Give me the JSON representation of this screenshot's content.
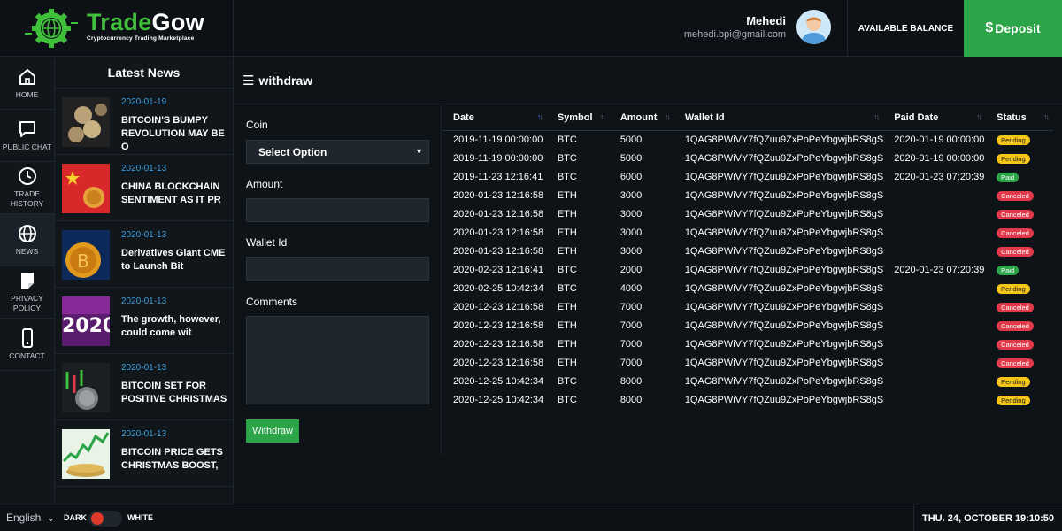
{
  "brand": {
    "name_part1": "Trade",
    "name_part2": "Gow",
    "tagline": "Cryptocurrency Trading Marketplace"
  },
  "user": {
    "name": "Mehedi",
    "email": "mehedi.bpi@gmail.com"
  },
  "header": {
    "balance_label": "AVAILABLE BALANCE",
    "deposit_symbol": "$",
    "deposit_label": "Deposit"
  },
  "sidebar": {
    "items": [
      {
        "label": "HOME",
        "icon": "home-icon"
      },
      {
        "label": "PUBLIC CHAT",
        "icon": "chat-icon"
      },
      {
        "label": "TRADE HISTORY",
        "icon": "clock-icon"
      },
      {
        "label": "NEWS",
        "icon": "globe-icon"
      },
      {
        "label": "PRIVACY POLICY",
        "icon": "document-icon"
      },
      {
        "label": "CONTACT",
        "icon": "phone-icon"
      }
    ]
  },
  "news": {
    "title": "Latest News",
    "items": [
      {
        "date": "2020-01-19",
        "headline": "BITCOIN'S BUMPY REVOLUTION MAY BE O"
      },
      {
        "date": "2020-01-13",
        "headline": "CHINA BLOCKCHAIN SENTIMENT AS IT PR"
      },
      {
        "date": "2020-01-13",
        "headline": "Derivatives Giant CME to Launch Bit"
      },
      {
        "date": "2020-01-13",
        "headline": "The growth, however, could come wit"
      },
      {
        "date": "2020-01-13",
        "headline": "BITCOIN SET FOR POSITIVE CHRISTMAS"
      },
      {
        "date": "2020-01-13",
        "headline": "BITCOIN PRICE GETS CHRISTMAS BOOST,"
      }
    ]
  },
  "page": {
    "title": "withdraw"
  },
  "form": {
    "coin_label": "Coin",
    "coin_select": "Select Option",
    "amount_label": "Amount",
    "wallet_label": "Wallet Id",
    "comments_label": "Comments",
    "submit_label": "Withdraw"
  },
  "table": {
    "columns": [
      "Date",
      "Symbol",
      "Amount",
      "Wallet Id",
      "Paid Date",
      "Status"
    ],
    "rows": [
      {
        "date": "2019-11-19 00:00:00",
        "symbol": "BTC",
        "amount": "5000",
        "wallet": "1QAG8PWiVY7fQZuu9ZxPoPeYbgwjbRS8gS",
        "paid": "2020-01-19 00:00:00",
        "status": "Pending"
      },
      {
        "date": "2019-11-19 00:00:00",
        "symbol": "BTC",
        "amount": "5000",
        "wallet": "1QAG8PWiVY7fQZuu9ZxPoPeYbgwjbRS8gS",
        "paid": "2020-01-19 00:00:00",
        "status": "Pending"
      },
      {
        "date": "2019-11-23 12:16:41",
        "symbol": "BTC",
        "amount": "6000",
        "wallet": "1QAG8PWiVY7fQZuu9ZxPoPeYbgwjbRS8gS",
        "paid": "2020-01-23 07:20:39",
        "status": "Paid"
      },
      {
        "date": "2020-01-23 12:16:58",
        "symbol": "ETH",
        "amount": "3000",
        "wallet": "1QAG8PWiVY7fQZuu9ZxPoPeYbgwjbRS8gS",
        "paid": "",
        "status": "Canceled"
      },
      {
        "date": "2020-01-23 12:16:58",
        "symbol": "ETH",
        "amount": "3000",
        "wallet": "1QAG8PWiVY7fQZuu9ZxPoPeYbgwjbRS8gS",
        "paid": "",
        "status": "Canceled"
      },
      {
        "date": "2020-01-23 12:16:58",
        "symbol": "ETH",
        "amount": "3000",
        "wallet": "1QAG8PWiVY7fQZuu9ZxPoPeYbgwjbRS8gS",
        "paid": "",
        "status": "Canceled"
      },
      {
        "date": "2020-01-23 12:16:58",
        "symbol": "ETH",
        "amount": "3000",
        "wallet": "1QAG8PWiVY7fQZuu9ZxPoPeYbgwjbRS8gS",
        "paid": "",
        "status": "Canceled"
      },
      {
        "date": "2020-02-23 12:16:41",
        "symbol": "BTC",
        "amount": "2000",
        "wallet": "1QAG8PWiVY7fQZuu9ZxPoPeYbgwjbRS8gS",
        "paid": "2020-01-23 07:20:39",
        "status": "Paid"
      },
      {
        "date": "2020-02-25 10:42:34",
        "symbol": "BTC",
        "amount": "4000",
        "wallet": "1QAG8PWiVY7fQZuu9ZxPoPeYbgwjbRS8gS",
        "paid": "",
        "status": "Pending"
      },
      {
        "date": "2020-12-23 12:16:58",
        "symbol": "ETH",
        "amount": "7000",
        "wallet": "1QAG8PWiVY7fQZuu9ZxPoPeYbgwjbRS8gS",
        "paid": "",
        "status": "Canceled"
      },
      {
        "date": "2020-12-23 12:16:58",
        "symbol": "ETH",
        "amount": "7000",
        "wallet": "1QAG8PWiVY7fQZuu9ZxPoPeYbgwjbRS8gS",
        "paid": "",
        "status": "Canceled"
      },
      {
        "date": "2020-12-23 12:16:58",
        "symbol": "ETH",
        "amount": "7000",
        "wallet": "1QAG8PWiVY7fQZuu9ZxPoPeYbgwjbRS8gS",
        "paid": "",
        "status": "Canceled"
      },
      {
        "date": "2020-12-23 12:16:58",
        "symbol": "ETH",
        "amount": "7000",
        "wallet": "1QAG8PWiVY7fQZuu9ZxPoPeYbgwjbRS8gS",
        "paid": "",
        "status": "Canceled"
      },
      {
        "date": "2020-12-25 10:42:34",
        "symbol": "BTC",
        "amount": "8000",
        "wallet": "1QAG8PWiVY7fQZuu9ZxPoPeYbgwjbRS8gS",
        "paid": "",
        "status": "Pending"
      },
      {
        "date": "2020-12-25 10:42:34",
        "symbol": "BTC",
        "amount": "8000",
        "wallet": "1QAG8PWiVY7fQZuu9ZxPoPeYbgwjbRS8gS",
        "paid": "",
        "status": "Pending"
      }
    ]
  },
  "footer": {
    "language": "English",
    "dark_label": "DARK",
    "white_label": "WHITE",
    "datetime": "THU. 24, OCTOBER  19:10:50"
  },
  "colors": {
    "accent": "#2ba547",
    "brand_green": "#3fbf3a",
    "link_blue": "#3a9fe0",
    "pending": "#f5c518",
    "canceled": "#e0394a",
    "background": "#0e1318"
  }
}
